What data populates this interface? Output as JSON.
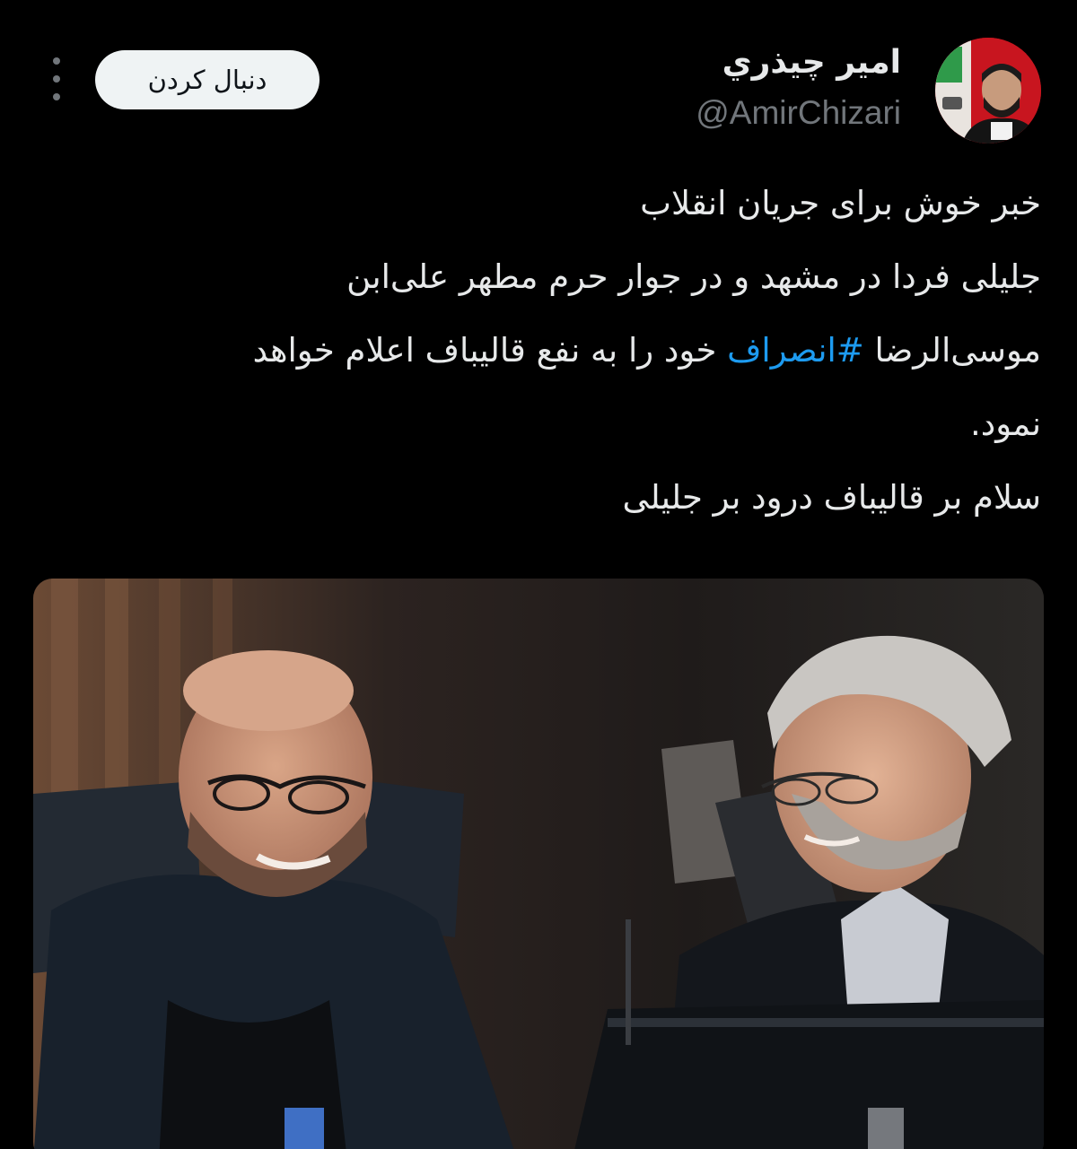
{
  "header": {
    "display_name": "امير چيذري",
    "handle": "@AmirChizari",
    "follow_label": "دنبال کردن",
    "more_icon": "more-vertical-icon",
    "avatar": "profile-photo"
  },
  "tweet": {
    "lines": [
      {
        "text": "خبر خوش برای جریان انقلاب"
      },
      {
        "text": "جلیلی فردا در مشهد و در جوار حرم مطهر علی‌ابن"
      },
      {
        "before": "موسی‌الرضا ",
        "hashtag": "#انصراف",
        "after": " خود را به نفع قالیباف اعلام خواهد"
      },
      {
        "text": "نمود."
      },
      {
        "text": "سلام بر قالیباف درود بر جلیلی"
      }
    ]
  },
  "colors": {
    "background": "#000000",
    "text": "#e7e9ea",
    "secondary": "#71767b",
    "hashtag": "#1d9bf0",
    "follow_bg": "#eff3f4"
  },
  "media": {
    "type": "photo",
    "description_icon": "photo-two-men-smiling"
  }
}
